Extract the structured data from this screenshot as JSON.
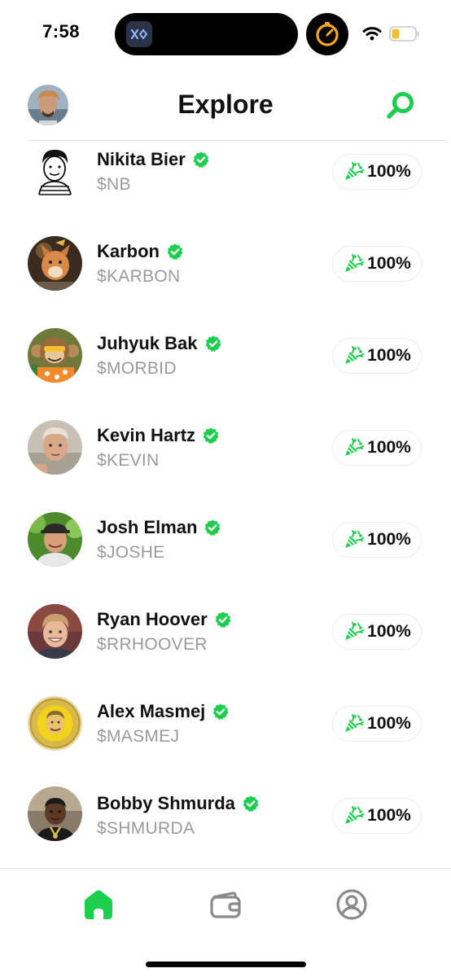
{
  "status_bar": {
    "time": "7:58"
  },
  "header": {
    "title": "Explore"
  },
  "colors": {
    "accent": "#1DCE4E",
    "ticker_gray": "#9A9A9A",
    "timer_orange": "#F5A623"
  },
  "icons": {
    "search": "search-icon",
    "verified": "verified-badge-icon",
    "pill": "party-popper-icon",
    "tabs": [
      "home-icon",
      "wallet-icon",
      "profile-icon"
    ]
  },
  "creators": [
    {
      "name": "Nikita Bier",
      "ticker": "$NB",
      "percent": "100%",
      "verified": true
    },
    {
      "name": "Karbon",
      "ticker": "$KARBON",
      "percent": "100%",
      "verified": true
    },
    {
      "name": "Juhyuk Bak",
      "ticker": "$MORBID",
      "percent": "100%",
      "verified": true
    },
    {
      "name": "Kevin Hartz",
      "ticker": "$KEVIN",
      "percent": "100%",
      "verified": true
    },
    {
      "name": "Josh Elman",
      "ticker": "$JOSHE",
      "percent": "100%",
      "verified": true
    },
    {
      "name": "Ryan Hoover",
      "ticker": "$RRHOOVER",
      "percent": "100%",
      "verified": true
    },
    {
      "name": "Alex Masmej",
      "ticker": "$MASMEJ",
      "percent": "100%",
      "verified": true
    },
    {
      "name": "Bobby Shmurda",
      "ticker": "$SHMURDA",
      "percent": "100%",
      "verified": true
    }
  ],
  "tab_bar": {
    "selected": "home"
  }
}
